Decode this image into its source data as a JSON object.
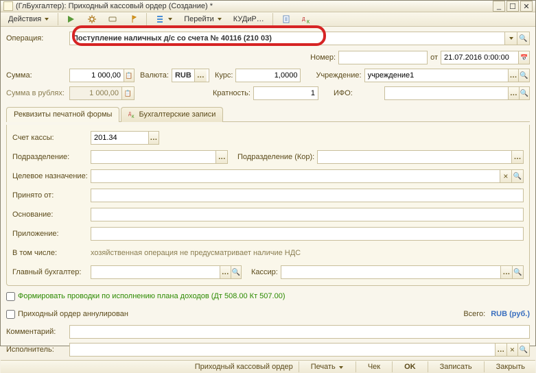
{
  "window": {
    "title": "(ГлБухгалтер): Приходный кассовый ордер (Создание) *"
  },
  "toolbar": {
    "actions": "Действия",
    "goto": "Перейти",
    "kud": "КУДиР…"
  },
  "operation": {
    "label": "Операция:",
    "value": "Поступление наличных д/с со счета № 40116 (210 03)"
  },
  "header": {
    "number_label": "Номер:",
    "number": "",
    "from_label": "от",
    "date": "21.07.2016 0:00:00",
    "sum_label": "Сумма:",
    "sum": "1 000,00",
    "sum_rub_label": "Сумма в рублях:",
    "sum_rub": "1 000,00",
    "currency_label": "Валюта:",
    "currency": "RUB",
    "rate_label": "Курс:",
    "rate": "1,0000",
    "mult_label": "Кратность:",
    "mult": "1",
    "org_label": "Учреждение:",
    "org": "учреждение1",
    "ifo_label": "ИФО:"
  },
  "tabs": {
    "tab1": "Реквизиты печатной формы",
    "tab2": "Бухгалтерские записи"
  },
  "form": {
    "account_label": "Счет кассы:",
    "account": "201.34",
    "div_label": "Подразделение:",
    "div_kor_label": "Подразделение (Кор):",
    "purpose_label": "Целевое назначение:",
    "from_label": "Принято от:",
    "reason_label": "Основание:",
    "attach_label": "Приложение:",
    "incl_label": "В том числе:",
    "incl_note": "хозяйственная операция не предусматривает наличие НДС",
    "chief_label": "Главный бухгалтер:",
    "cashier_label": "Кассир:"
  },
  "below": {
    "checkbox1": "Формировать проводки по исполнению плана доходов (Дт 508.00 Кт 507.00)",
    "checkbox2": "Приходный ордер аннулирован",
    "total_label": "Всего:",
    "total_cur": "RUB (руб.)",
    "comment_label": "Комментарий:",
    "executor_label": "Исполнитель:"
  },
  "footer": {
    "doclink": "Приходный кассовый ордер",
    "print": "Печать",
    "check": "Чек",
    "ok": "OK",
    "save": "Записать",
    "close": "Закрыть"
  }
}
